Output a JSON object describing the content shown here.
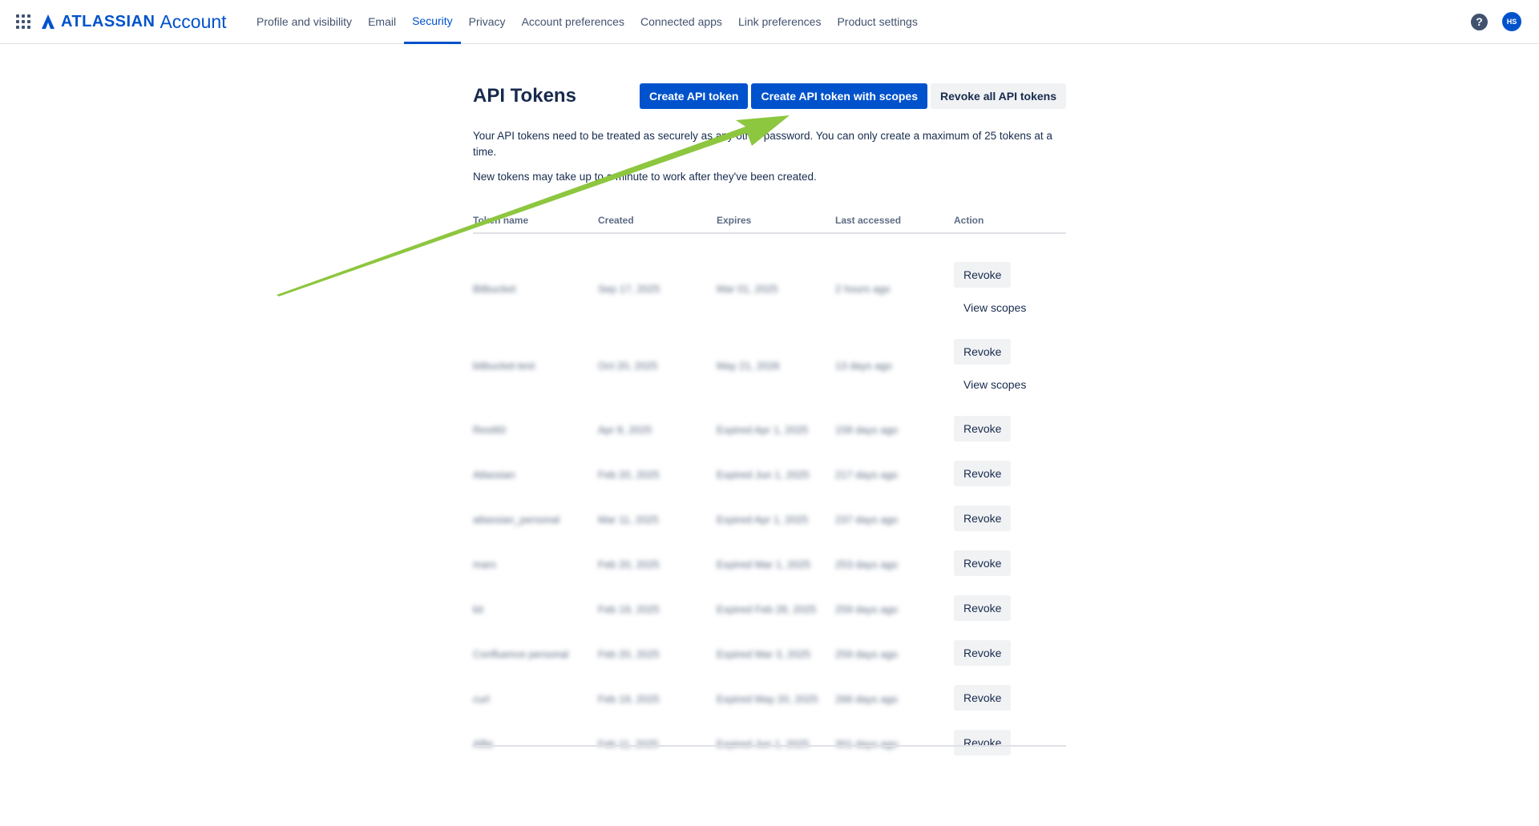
{
  "header": {
    "logo_brand": "ATLASSIAN",
    "logo_product": "Account",
    "nav": [
      {
        "label": "Profile and visibility"
      },
      {
        "label": "Email"
      },
      {
        "label": "Security",
        "active": true
      },
      {
        "label": "Privacy"
      },
      {
        "label": "Account preferences"
      },
      {
        "label": "Connected apps"
      },
      {
        "label": "Link preferences"
      },
      {
        "label": "Product settings"
      }
    ],
    "help_glyph": "?",
    "avatar_initials": "HS"
  },
  "page": {
    "title": "API Tokens",
    "buttons": {
      "create": "Create API token",
      "create_scoped": "Create API token with scopes",
      "revoke_all": "Revoke all API tokens"
    },
    "description": "Your API tokens need to be treated as securely as any other password. You can only create a maximum of 25 tokens at a time.",
    "note": "New tokens may take up to a minute to work after they've been created."
  },
  "table": {
    "columns": [
      "Token name",
      "Created",
      "Expires",
      "Last accessed",
      "Action"
    ],
    "revoke_label": "Revoke",
    "view_scopes_label": "View scopes",
    "rows": [
      {
        "name": "Bitbucket",
        "created": "Sep 17, 2025",
        "expires": "Mar 01, 2025",
        "last": "2 hours ago",
        "scoped": true
      },
      {
        "name": "bitbucket-test",
        "created": "Oct 20, 2025",
        "expires": "May 21, 2026",
        "last": "13 days ago",
        "scoped": true
      },
      {
        "name": "Rest60",
        "created": "Apr 8, 2025",
        "expires": "Expired Apr 1, 2025",
        "last": "158 days ago",
        "scoped": false
      },
      {
        "name": "Atlassian",
        "created": "Feb 20, 2025",
        "expires": "Expired Jun 1, 2025",
        "last": "217 days ago",
        "scoped": false
      },
      {
        "name": "atlassian_personal",
        "created": "Mar 11, 2025",
        "expires": "Expired Apr 1, 2025",
        "last": "237 days ago",
        "scoped": false
      },
      {
        "name": "mars",
        "created": "Feb 20, 2025",
        "expires": "Expired Mar 1, 2025",
        "last": "253 days ago",
        "scoped": false
      },
      {
        "name": "kit",
        "created": "Feb 19, 2025",
        "expires": "Expired Feb 28, 2025",
        "last": "259 days ago",
        "scoped": false
      },
      {
        "name": "Confluence personal",
        "created": "Feb 20, 2025",
        "expires": "Expired Mar 3, 2025",
        "last": "259 days ago",
        "scoped": false
      },
      {
        "name": "curl",
        "created": "Feb 19, 2025",
        "expires": "Expired May 20, 2025",
        "last": "266 days ago",
        "scoped": false
      },
      {
        "name": "Alfie",
        "created": "Feb 11, 2025",
        "expires": "Expired Jun 1, 2025",
        "last": "301 days ago",
        "scoped": false
      }
    ]
  },
  "colors": {
    "brand": "#0052cc",
    "annotation_arrow": "#8dc63f"
  }
}
